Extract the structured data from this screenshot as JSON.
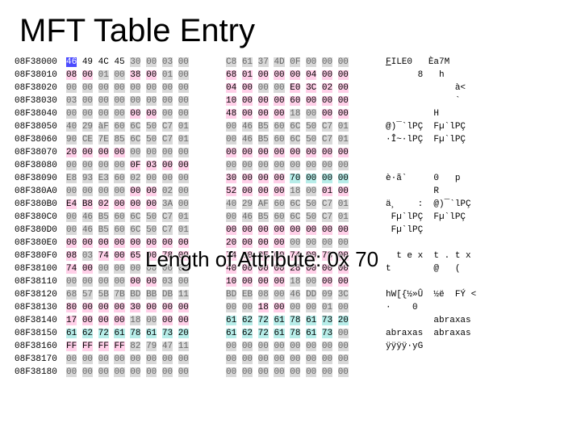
{
  "title": "MFT Table Entry",
  "annotation": {
    "text": "Length of Attribute: 0x 70"
  },
  "hex_offsets_prefix": "08F380",
  "rows": [
    {
      "off": "08F38000",
      "left": [
        "46",
        "49",
        "4C",
        "45",
        "30",
        "00",
        "03",
        "00"
      ],
      "right": [
        "C8",
        "61",
        "37",
        "4D",
        "0F",
        "00",
        "00",
        "00"
      ],
      "ascii_left": "FILE0   Èa7M    ",
      "hl": {
        "cursor": [
          0
        ],
        "gray_left": [
          4,
          5,
          6,
          7
        ],
        "gray_right": [
          0,
          1,
          2,
          3,
          4,
          5,
          6,
          7
        ],
        "ascii_under": [
          0
        ]
      }
    },
    {
      "off": "08F38010",
      "left": [
        "08",
        "00",
        "01",
        "00",
        "38",
        "00",
        "01",
        "00"
      ],
      "right": [
        "68",
        "01",
        "00",
        "00",
        "00",
        "04",
        "00",
        "00"
      ],
      "ascii_left": "      8   h      ",
      "hl": {
        "pink_left": [
          0,
          1
        ],
        "gray_left": [
          2,
          3
        ],
        "pink_left2": [
          4,
          5
        ],
        "gray_left2": [
          6,
          7
        ],
        "pink_right": [
          0,
          1,
          2,
          3,
          4,
          5,
          6,
          7
        ]
      }
    },
    {
      "off": "08F38020",
      "left": [
        "00",
        "00",
        "00",
        "00",
        "00",
        "00",
        "00",
        "00"
      ],
      "right": [
        "04",
        "00",
        "00",
        "00",
        "E0",
        "3C",
        "02",
        "00"
      ],
      "ascii_left": "             à<  ",
      "hl": {
        "gray_left": [
          0,
          1,
          2,
          3,
          4,
          5,
          6,
          7
        ],
        "pink_right": [
          0,
          1
        ],
        "gray_right": [
          2,
          3
        ],
        "pink_right2": [
          4,
          5,
          6,
          7
        ]
      }
    },
    {
      "off": "08F38030",
      "left": [
        "03",
        "00",
        "00",
        "00",
        "00",
        "00",
        "00",
        "00"
      ],
      "right": [
        "10",
        "00",
        "00",
        "00",
        "60",
        "00",
        "00",
        "00"
      ],
      "ascii_left": "             `   ",
      "hl": {
        "gray_left": [
          0,
          1,
          2,
          3,
          4,
          5,
          6,
          7
        ],
        "pink_right": [
          0,
          1,
          2,
          3,
          4,
          5,
          6,
          7
        ]
      }
    },
    {
      "off": "08F38040",
      "left": [
        "00",
        "00",
        "00",
        "00",
        "00",
        "00",
        "00",
        "00"
      ],
      "right": [
        "48",
        "00",
        "00",
        "00",
        "18",
        "00",
        "00",
        "00"
      ],
      "ascii_left": "         H       ",
      "hl": {
        "gray_left": [
          0,
          1,
          2,
          3
        ],
        "pink_left": [
          4,
          5
        ],
        "gray_left2": [
          6,
          7
        ],
        "pink_right": [
          0,
          1,
          2,
          3
        ],
        "gray_right": [
          4,
          5
        ],
        "pink_right2": [
          6,
          7
        ]
      }
    },
    {
      "off": "08F38050",
      "left": [
        "40",
        "29",
        "àF",
        "60",
        "6C",
        "50",
        "C7",
        "01"
      ],
      "right": [
        "00",
        "46",
        "B5",
        "60",
        "6C",
        "50",
        "C7",
        "01"
      ],
      "ascii_left": "@)¯`lPÇ  Fµ`lPÇ",
      "hl": {
        "gray_left": [
          0,
          1,
          2,
          3,
          4,
          5,
          6,
          7
        ],
        "gray_right": [
          0,
          1,
          2,
          3,
          4,
          5,
          6,
          7
        ]
      }
    },
    {
      "off": "08F38060",
      "left": [
        "90",
        "CE",
        "7E",
        "85",
        "6C",
        "50",
        "C7",
        "01"
      ],
      "right": [
        "00",
        "46",
        "B5",
        "60",
        "6C",
        "50",
        "C7",
        "01"
      ],
      "ascii_left": "·Î~·lPÇ  Fµ`lPÇ",
      "hl": {
        "gray_left": [
          0,
          1,
          2,
          3,
          4,
          5,
          6,
          7
        ],
        "gray_right": [
          0,
          1,
          2,
          3,
          4,
          5,
          6,
          7
        ]
      }
    },
    {
      "off": "08F38070",
      "left": [
        "20",
        "00",
        "00",
        "00",
        "00",
        "00",
        "00",
        "00"
      ],
      "right": [
        "00",
        "00",
        "00",
        "00",
        "00",
        "00",
        "00",
        "00"
      ],
      "ascii_left": "                 ",
      "hl": {
        "pink_left": [
          0,
          1,
          2,
          3
        ],
        "gray_left": [
          4,
          5,
          6,
          7
        ],
        "pink_right": [
          0,
          1,
          2,
          3,
          4,
          5,
          6,
          7
        ]
      }
    },
    {
      "off": "08F38080",
      "left": [
        "00",
        "00",
        "00",
        "00",
        "0F",
        "03",
        "00",
        "00"
      ],
      "right": [
        "00",
        "00",
        "00",
        "00",
        "00",
        "00",
        "00",
        "00"
      ],
      "ascii_left": "                 ",
      "hl": {
        "gray_left": [
          0,
          1,
          2,
          3
        ],
        "pink_left": [
          4,
          5,
          6,
          7
        ],
        "gray_right": [
          0,
          1,
          2,
          3,
          4,
          5,
          6,
          7
        ]
      }
    },
    {
      "off": "08F38090",
      "left": [
        "E8",
        "93",
        "E3",
        "60",
        "02",
        "00",
        "00",
        "00"
      ],
      "right": [
        "30",
        "00",
        "00",
        "00",
        "70",
        "00",
        "00",
        "00"
      ],
      "ascii_left": "è·ã`     0   p   ",
      "hl": {
        "gray_left": [
          0,
          1,
          2,
          3,
          4,
          5,
          6,
          7
        ],
        "pink_right": [
          0,
          1,
          2,
          3
        ],
        "cyan_right": [
          4,
          5,
          6,
          7
        ]
      }
    },
    {
      "off": "08F380A0",
      "left": [
        "00",
        "00",
        "00",
        "00",
        "00",
        "00",
        "02",
        "00"
      ],
      "right": [
        "52",
        "00",
        "00",
        "00",
        "18",
        "00",
        "01",
        "00"
      ],
      "ascii_left": "         R       ",
      "hl": {
        "gray_left": [
          0,
          1,
          2,
          3
        ],
        "pink_left": [
          4,
          5
        ],
        "gray_left2": [
          6,
          7
        ],
        "pink_right": [
          0,
          1,
          2,
          3
        ],
        "gray_right": [
          4,
          5
        ],
        "pink_right2": [
          6,
          7
        ]
      }
    },
    {
      "off": "08F380B0",
      "left": [
        "E4",
        "B8",
        "02",
        "00",
        "00",
        "00",
        "3A",
        "00"
      ],
      "right": [
        "40",
        "29",
        "AF",
        "60",
        "6C",
        "50",
        "C7",
        "01"
      ],
      "ascii_left": "ä¸    :  @)¯`lPÇ",
      "hl": {
        "pink_left": [
          0,
          1,
          2,
          3,
          4,
          5
        ],
        "gray_left": [
          6,
          7
        ],
        "gray_right": [
          0,
          1,
          2,
          3,
          4,
          5,
          6,
          7
        ]
      }
    },
    {
      "off": "08F380C0",
      "left": [
        "00",
        "46",
        "B5",
        "60",
        "6C",
        "50",
        "C7",
        "01"
      ],
      "right": [
        "00",
        "46",
        "B5",
        "60",
        "6C",
        "50",
        "C7",
        "01"
      ],
      "ascii_left": " Fµ`lPÇ  Fµ`lPÇ",
      "hl": {
        "gray_left": [
          0,
          1,
          2,
          3,
          4,
          5,
          6,
          7
        ],
        "gray_right": [
          0,
          1,
          2,
          3,
          4,
          5,
          6,
          7
        ]
      }
    },
    {
      "off": "08F380D0",
      "left": [
        "00",
        "46",
        "B5",
        "60",
        "6C",
        "50",
        "C7",
        "01"
      ],
      "right": [
        "00",
        "00",
        "00",
        "00",
        "00",
        "00",
        "00",
        "00"
      ],
      "ascii_left": " Fµ`lPÇ          ",
      "hl": {
        "gray_left": [
          0,
          1,
          2,
          3,
          4,
          5,
          6,
          7
        ],
        "pink_right": [
          0,
          1,
          2,
          3,
          4,
          5,
          6,
          7
        ]
      }
    },
    {
      "off": "08F380E0",
      "left": [
        "00",
        "00",
        "00",
        "00",
        "00",
        "00",
        "00",
        "00"
      ],
      "right": [
        "20",
        "00",
        "00",
        "00",
        "00",
        "00",
        "00",
        "00"
      ],
      "ascii_left": "                 ",
      "hl": {
        "pink_left": [
          0,
          1,
          2,
          3,
          4,
          5,
          6,
          7
        ],
        "pink_right": [
          0,
          1,
          2,
          3
        ],
        "gray_right": [
          4,
          5,
          6,
          7
        ]
      }
    },
    {
      "off": "08F380F0",
      "left": [
        "08",
        "03",
        "74",
        "00",
        "65",
        "00",
        "78",
        "00"
      ],
      "right": [
        "74",
        "00",
        "2E",
        "00",
        "74",
        "00",
        "78",
        "00"
      ],
      "ascii_left": "  t e x  t . t x",
      "hl": {
        "pink_left": [
          0
        ],
        "gray_left": [
          1
        ],
        "pink_left2": [
          2,
          3,
          4,
          5,
          6,
          7
        ],
        "pink_right": [
          0,
          1,
          2,
          3,
          4,
          5,
          6,
          7
        ]
      }
    },
    {
      "off": "08F38100",
      "left": [
        "74",
        "00",
        "00",
        "00",
        "00",
        "00",
        "00",
        "00"
      ],
      "right": [
        "40",
        "00",
        "00",
        "00",
        "28",
        "00",
        "00",
        "00"
      ],
      "ascii_left": "t        @   (   ",
      "hl": {
        "pink_left": [
          0,
          1
        ],
        "gray_left": [
          2,
          3,
          4,
          5,
          6,
          7
        ],
        "pink_right": [
          0,
          1,
          2,
          3,
          4,
          5,
          6,
          7
        ]
      }
    },
    {
      "off": "08F38110",
      "left": [
        "00",
        "00",
        "00",
        "00",
        "00",
        "00",
        "03",
        "00"
      ],
      "right": [
        "10",
        "00",
        "00",
        "00",
        "18",
        "00",
        "00",
        "00"
      ],
      "ascii_left": "                 ",
      "hl": {
        "gray_left": [
          0,
          1,
          2,
          3
        ],
        "pink_left": [
          4,
          5
        ],
        "gray_left2": [
          6,
          7
        ],
        "pink_right": [
          0,
          1,
          2,
          3
        ],
        "gray_right": [
          4,
          5
        ],
        "pink_right2": [
          6,
          7
        ]
      }
    },
    {
      "off": "08F38120",
      "left": [
        "68",
        "57",
        "5B",
        "7B",
        "BD",
        "BB",
        "DB",
        "11"
      ],
      "right": [
        "BD",
        "EB",
        "08",
        "00",
        "46",
        "DD",
        "09",
        "3C"
      ],
      "ascii_left": "hW[{½»Û  ½ë  FÝ <",
      "hl": {
        "gray_left": [
          0,
          1,
          2,
          3,
          4,
          5,
          6,
          7
        ],
        "gray_right": [
          0,
          1,
          2,
          3,
          4,
          5,
          6,
          7
        ]
      }
    },
    {
      "off": "08F38130",
      "left": [
        "80",
        "00",
        "00",
        "00",
        "30",
        "00",
        "00",
        "00"
      ],
      "right": [
        "00",
        "00",
        "18",
        "00",
        "00",
        "00",
        "01",
        "00"
      ],
      "ascii_left": "·    0           ",
      "hl": {
        "pink_left": [
          0,
          1,
          2,
          3,
          4,
          5,
          6,
          7
        ],
        "gray_right": [
          0,
          1
        ],
        "pink_right": [
          2,
          3
        ],
        "gray_right2": [
          4,
          5,
          6,
          7
        ]
      }
    },
    {
      "off": "08F38140",
      "left": [
        "17",
        "00",
        "00",
        "00",
        "18",
        "00",
        "00",
        "00"
      ],
      "right": [
        "61",
        "62",
        "72",
        "61",
        "78",
        "61",
        "73",
        "20"
      ],
      "ascii_left": "         abraxas ",
      "hl": {
        "pink_left": [
          0,
          1,
          2,
          3
        ],
        "gray_left": [
          4,
          5
        ],
        "pink_left2": [
          6,
          7
        ],
        "cyan_right": [
          0,
          1,
          2,
          3,
          4,
          5,
          6,
          7
        ]
      }
    },
    {
      "off": "08F38150",
      "left": [
        "61",
        "62",
        "72",
        "61",
        "78",
        "61",
        "73",
        "20"
      ],
      "right": [
        "61",
        "62",
        "72",
        "61",
        "78",
        "61",
        "73",
        "00"
      ],
      "ascii_left": "abraxas  abraxas ",
      "hl": {
        "cyan_left": [
          0,
          1,
          2,
          3,
          4,
          5,
          6,
          7
        ],
        "cyan_right": [
          0,
          1,
          2,
          3,
          4,
          5,
          6
        ],
        "gray_right": [
          7
        ]
      }
    },
    {
      "off": "08F38160",
      "left": [
        "FF",
        "FF",
        "FF",
        "FF",
        "82",
        "79",
        "47",
        "11"
      ],
      "right": [
        "00",
        "00",
        "00",
        "00",
        "00",
        "00",
        "00",
        "00"
      ],
      "ascii_left": "ÿÿÿÿ·yG          ",
      "hl": {
        "pink_left": [
          0,
          1,
          2,
          3
        ],
        "gray_left": [
          4,
          5,
          6,
          7
        ],
        "gray_right": [
          0,
          1,
          2,
          3,
          4,
          5,
          6,
          7
        ]
      }
    },
    {
      "off": "08F38170",
      "left": [
        "00",
        "00",
        "00",
        "00",
        "00",
        "00",
        "00",
        "00"
      ],
      "right": [
        "00",
        "00",
        "00",
        "00",
        "00",
        "00",
        "00",
        "00"
      ],
      "ascii_left": "                 ",
      "hl": {
        "gray_left": [
          0,
          1,
          2,
          3,
          4,
          5,
          6,
          7
        ],
        "gray_right": [
          0,
          1,
          2,
          3,
          4,
          5,
          6,
          7
        ]
      }
    },
    {
      "off": "08F38180",
      "left": [
        "00",
        "00",
        "00",
        "00",
        "00",
        "00",
        "00",
        "00"
      ],
      "right": [
        "00",
        "00",
        "00",
        "00",
        "00",
        "00",
        "00",
        "00"
      ],
      "ascii_left": "                 ",
      "hl": {
        "gray_left": [
          0,
          1,
          2,
          3,
          4,
          5,
          6,
          7
        ],
        "gray_right": [
          0,
          1,
          2,
          3,
          4,
          5,
          6,
          7
        ]
      }
    }
  ],
  "colors": {
    "pink": "#ffcfe8",
    "gray": "#d8d8d8",
    "cyan": "#b7ede9",
    "cursor": "#4b4bff"
  }
}
